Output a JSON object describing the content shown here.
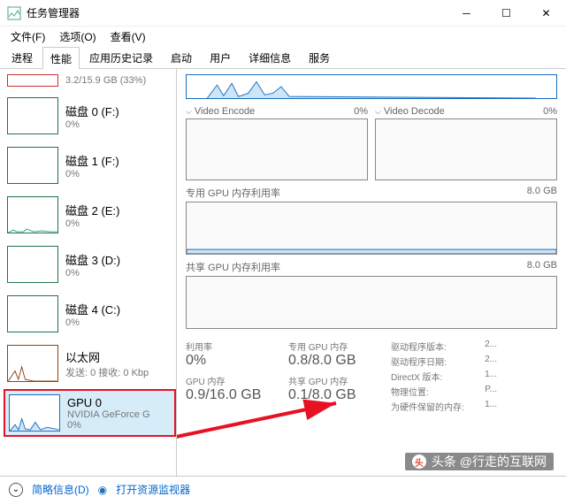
{
  "window": {
    "title": "任务管理器"
  },
  "menu": {
    "file": "文件(F)",
    "options": "选项(O)",
    "view": "查看(V)"
  },
  "tabs": [
    "进程",
    "性能",
    "应用历史记录",
    "启动",
    "用户",
    "详细信息",
    "服务"
  ],
  "active_tab": "性能",
  "sidebar": {
    "items": [
      {
        "name": "",
        "val": "3.2/15.9 GB (33%)"
      },
      {
        "name": "磁盘 0 (F:)",
        "val": "0%"
      },
      {
        "name": "磁盘 1 (F:)",
        "val": "0%"
      },
      {
        "name": "磁盘 2 (E:)",
        "val": "0%"
      },
      {
        "name": "磁盘 3 (D:)",
        "val": "0%"
      },
      {
        "name": "磁盘 4 (C:)",
        "val": "0%"
      },
      {
        "name": "以太网",
        "val": "发送: 0 接收: 0 Kbp"
      },
      {
        "name": "GPU 0",
        "val2": "NVIDIA GeForce G",
        "val": "0%"
      }
    ]
  },
  "charts": {
    "video_encode": {
      "label": "Video Encode",
      "pct": "0%"
    },
    "video_decode": {
      "label": "Video Decode",
      "pct": "0%"
    },
    "dedicated": {
      "label": "专用 GPU 内存利用率",
      "max": "8.0 GB"
    },
    "shared": {
      "label": "共享 GPU 内存利用率",
      "max": "8.0 GB"
    }
  },
  "stats": {
    "util": {
      "label": "利用率",
      "val": "0%"
    },
    "dedicated_mem": {
      "label": "专用 GPU 内存",
      "val": "0.8/8.0 GB"
    },
    "gpu_mem": {
      "label": "GPU 内存",
      "val": "0.9/16.0 GB"
    },
    "shared_mem": {
      "label": "共享 GPU 内存",
      "val": "0.1/8.0 GB"
    }
  },
  "info": {
    "driver_ver": {
      "label": "驱动程序版本:",
      "val": "2..."
    },
    "driver_date": {
      "label": "驱动程序日期:",
      "val": "2..."
    },
    "directx": {
      "label": "DirectX 版本:",
      "val": "1..."
    },
    "location": {
      "label": "物理位置:",
      "val": "P..."
    },
    "reserved": {
      "label": "为硬件保留的内存:",
      "val": "1..."
    }
  },
  "footer": {
    "brief": "简略信息(D)",
    "monitor": "打开资源监视器"
  },
  "watermark": "头条 @行走的互联网"
}
